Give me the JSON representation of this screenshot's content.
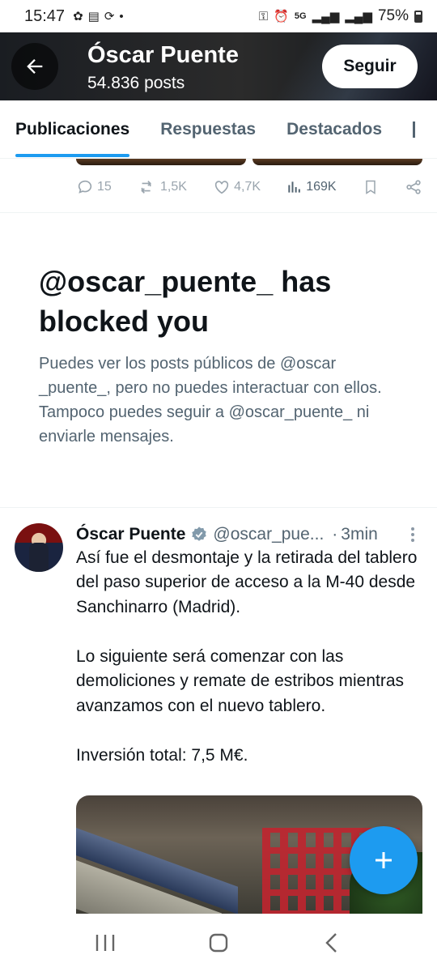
{
  "status_bar": {
    "time": "15:47",
    "network": "5G",
    "battery": "75%"
  },
  "header": {
    "name": "Óscar Puente",
    "posts": "54.836 posts",
    "follow_label": "Seguir"
  },
  "tabs": [
    {
      "label": "Publicaciones",
      "active": true
    },
    {
      "label": "Respuestas",
      "active": false
    },
    {
      "label": "Destacados",
      "active": false
    }
  ],
  "prev_tweet_actions": {
    "replies": "15",
    "reposts": "1,5K",
    "likes": "4,7K",
    "views": "169K"
  },
  "blocked": {
    "title": "@oscar_puente_ has blocked you",
    "description": "Puedes ver los posts públicos de @oscar _puente_, pero no puedes interactuar con ellos. Tampoco puedes seguir a @oscar_puente_ ni enviarle mensajes."
  },
  "tweet": {
    "name": "Óscar Puente",
    "handle": "@oscar_pue...",
    "time": "3min",
    "text": "Así fue el desmontaje y la retirada del tablero del paso superior de acceso a la M-40 desde Sanchinarro (Madrid).\n\nLo siguiente será comenzar con las demoliciones y remate de estribos mientras avanzamos con el nuevo tablero.\n\nInversión total: 7,5 M€."
  },
  "colors": {
    "accent": "#1d9bf0",
    "text_primary": "#0f1419",
    "text_secondary": "#536471"
  },
  "icons": [
    "back-arrow-icon",
    "verified-badge-icon",
    "reply-icon",
    "repost-icon",
    "like-icon",
    "views-icon",
    "bookmark-icon",
    "share-icon",
    "more-icon",
    "compose-plus-icon",
    "recents-icon",
    "home-icon",
    "back-nav-icon"
  ]
}
